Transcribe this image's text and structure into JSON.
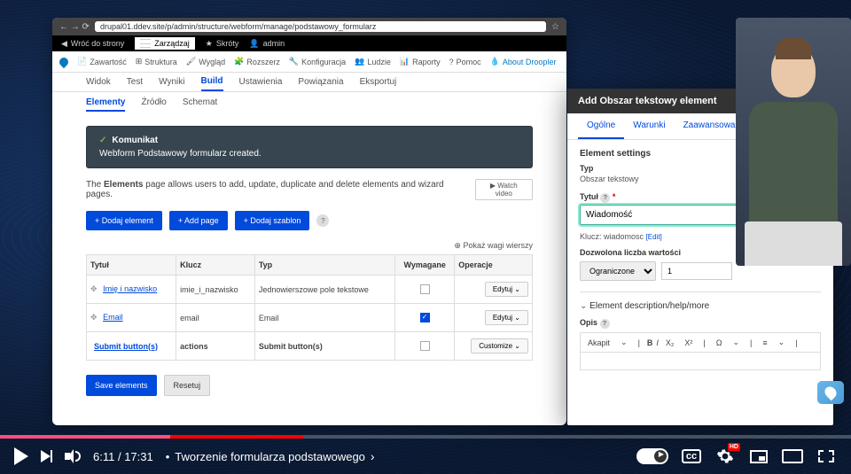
{
  "browser": {
    "url": "drupal01.ddev.site/p/admin/structure/webform/manage/podstawowy_formularz",
    "back_to_site": "Wróć do strony",
    "manage": "Zarządzaj",
    "shortcuts": "Skróty",
    "admin": "admin"
  },
  "toolbar": {
    "items": [
      "Zawartość",
      "Struktura",
      "Wygląd",
      "Rozszerz",
      "Konfiguracja",
      "Ludzie",
      "Raporty",
      "Pomoc",
      "About Droopler"
    ]
  },
  "tabs": {
    "primary": [
      "Widok",
      "Test",
      "Wyniki",
      "Build",
      "Ustawienia",
      "Powiązania",
      "Eksportuj"
    ],
    "active": "Build",
    "secondary": [
      "Elementy",
      "Źródło",
      "Schemat"
    ],
    "active2": "Elementy"
  },
  "alert": {
    "title": "Komunikat",
    "body": "Webform Podstawowy formularz created."
  },
  "page": {
    "desc_prefix": "The ",
    "desc_bold": "Elements",
    "desc_suffix": " page allows users to add, update, duplicate and delete elements and wizard pages.",
    "watch": "▶ Watch video",
    "btn_add_element": "+ Dodaj element",
    "btn_add_page": "+ Add page",
    "btn_add_template": "+ Dodaj szablon",
    "show_weights": "⊕ Pokaż wagi wierszy",
    "save": "Save elements",
    "reset": "Resetuj"
  },
  "table": {
    "headers": [
      "Tytuł",
      "Klucz",
      "Typ",
      "Wymagane",
      "Operacje"
    ],
    "rows": [
      {
        "title": "Imię i nazwisko",
        "key": "imie_i_nazwisko",
        "type": "Jednowierszowe pole tekstowe",
        "required": false,
        "op": "Edytuj",
        "link": true,
        "drag": true
      },
      {
        "title": "Email",
        "key": "email",
        "type": "Email",
        "required": true,
        "op": "Edytuj",
        "link": true,
        "drag": true
      },
      {
        "title": "Submit button(s)",
        "key": "actions",
        "type": "Submit button(s)",
        "required": false,
        "op": "Customize",
        "link": true,
        "bold": true,
        "drag": false
      }
    ]
  },
  "dialog": {
    "title": "Add Obszar tekstowy element",
    "tabs": [
      "Ogólne",
      "Warunki",
      "Zaawansowane"
    ],
    "active_tab": "Ogólne",
    "section": "Element settings",
    "type_label": "Typ",
    "type_value": "Obszar tekstowy",
    "title_label": "Tytuł",
    "title_required": "*",
    "title_value": "Wiadomość",
    "key_label": "Klucz: wiadomosc",
    "key_edit": "[Edit]",
    "allowed_label": "Dozwolona liczba wartości",
    "allowed_select": "Ograniczone",
    "allowed_num": "1",
    "accordion": "Element description/help/more",
    "opis_label": "Opis",
    "rte_style": "Akapit"
  },
  "player": {
    "current": "6:11",
    "total": "17:31",
    "chapter": "Tworzenie formularza podstawowego",
    "hd": "HD"
  }
}
